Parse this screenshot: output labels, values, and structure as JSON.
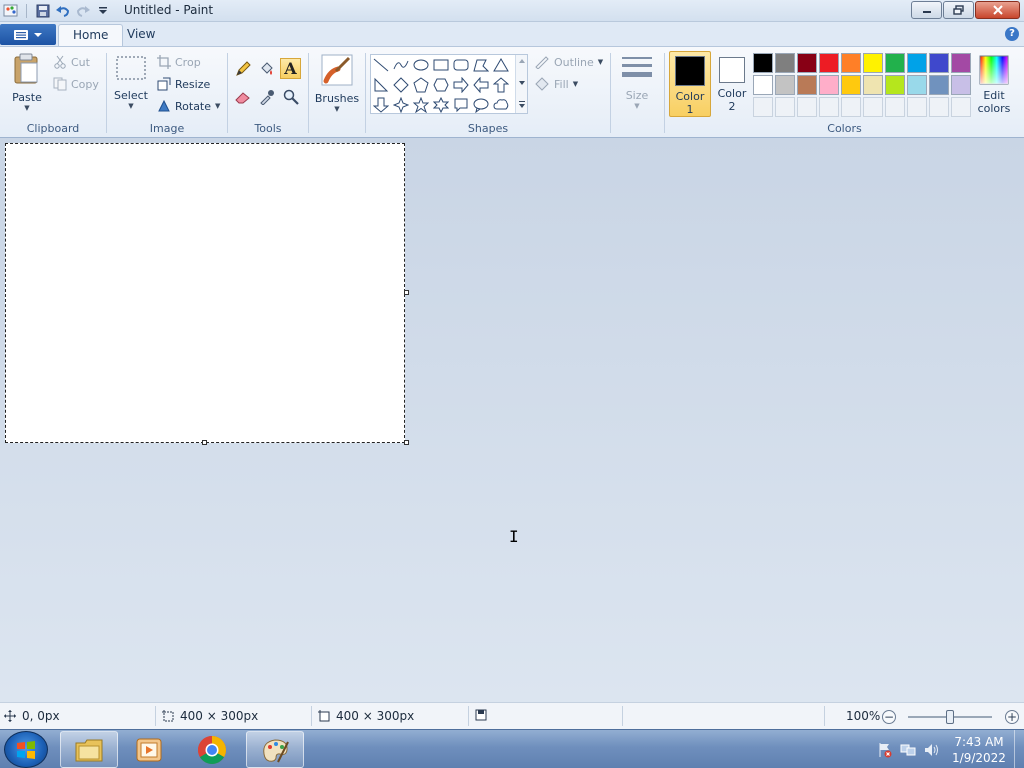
{
  "window": {
    "title": "Untitled - Paint"
  },
  "tabs": [
    {
      "label": "Home",
      "active": true
    },
    {
      "label": "View",
      "active": false
    }
  ],
  "help_label": "?",
  "clipboard": {
    "group_label": "Clipboard",
    "paste": "Paste",
    "cut": "Cut",
    "copy": "Copy"
  },
  "image": {
    "group_label": "Image",
    "select": "Select",
    "crop": "Crop",
    "resize": "Resize",
    "rotate": "Rotate"
  },
  "tools": {
    "group_label": "Tools",
    "text_glyph": "A"
  },
  "brushes": {
    "label": "Brushes"
  },
  "shapes": {
    "group_label": "Shapes",
    "outline": "Outline",
    "fill": "Fill"
  },
  "size": {
    "label": "Size"
  },
  "colors": {
    "group_label": "Colors",
    "color1_line1": "Color",
    "color1_line2": "1",
    "color2_line1": "Color",
    "color2_line2": "2",
    "edit_line1": "Edit",
    "edit_line2": "colors",
    "color1_value": "#000000",
    "color2_value": "#ffffff",
    "palette": [
      "#000000",
      "#7f7f7f",
      "#880015",
      "#ed1c24",
      "#ff7f27",
      "#fff200",
      "#22b14c",
      "#00a2e8",
      "#3f48cc",
      "#a349a4",
      "#ffffff",
      "#c3c3c3",
      "#b97a57",
      "#ffaec9",
      "#ffc90e",
      "#efe4b0",
      "#b5e61d",
      "#99d9ea",
      "#7092be",
      "#c8bfe7",
      "",
      "",
      "",
      "",
      "",
      "",
      "",
      "",
      "",
      ""
    ]
  },
  "status": {
    "cursor_pos": "0, 0px",
    "selection_size": "400 × 300px",
    "image_size": "400 × 300px",
    "zoom": "100%"
  },
  "taskbar": {
    "time": "7:43 AM",
    "date": "1/9/2022"
  }
}
